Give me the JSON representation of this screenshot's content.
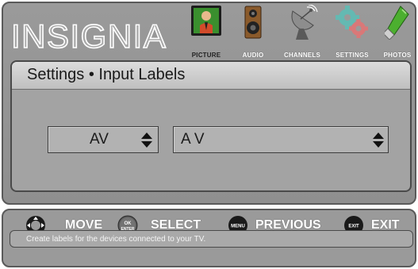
{
  "brand": {
    "logo_text": "INSIGNIA"
  },
  "menu_tabs": [
    {
      "label": "PICTURE",
      "icon": "picture-icon",
      "active": true
    },
    {
      "label": "AUDIO",
      "icon": "speaker-icon",
      "active": false
    },
    {
      "label": "CHANNELS",
      "icon": "satellite-dish-icon",
      "active": false
    },
    {
      "label": "SETTINGS",
      "icon": "gears-icon",
      "active": false
    },
    {
      "label": "PHOTOS",
      "icon": "usb-stick-icon",
      "active": false
    }
  ],
  "page": {
    "title": "Settings • Input Labels"
  },
  "input_label": {
    "source": "AV",
    "label": "A V"
  },
  "controls": {
    "move_label": "MOVE",
    "select_label": "SELECT",
    "ok_button_text": "OK",
    "enter_button_text": "ENTER",
    "previous_label": "PREVIOUS",
    "menu_button_text": "MENU",
    "exit_label": "EXIT",
    "exit_button_text": "EXIT"
  },
  "help_text": "Create labels for the devices connected to your TV.",
  "colors": {
    "panel": "#9a9a9a",
    "content": "#a3a3a3",
    "title_bar": "#d0d0d0",
    "field": "#b2b2b2",
    "text_dark": "#1b1b1b",
    "text_light": "#ffffff"
  }
}
